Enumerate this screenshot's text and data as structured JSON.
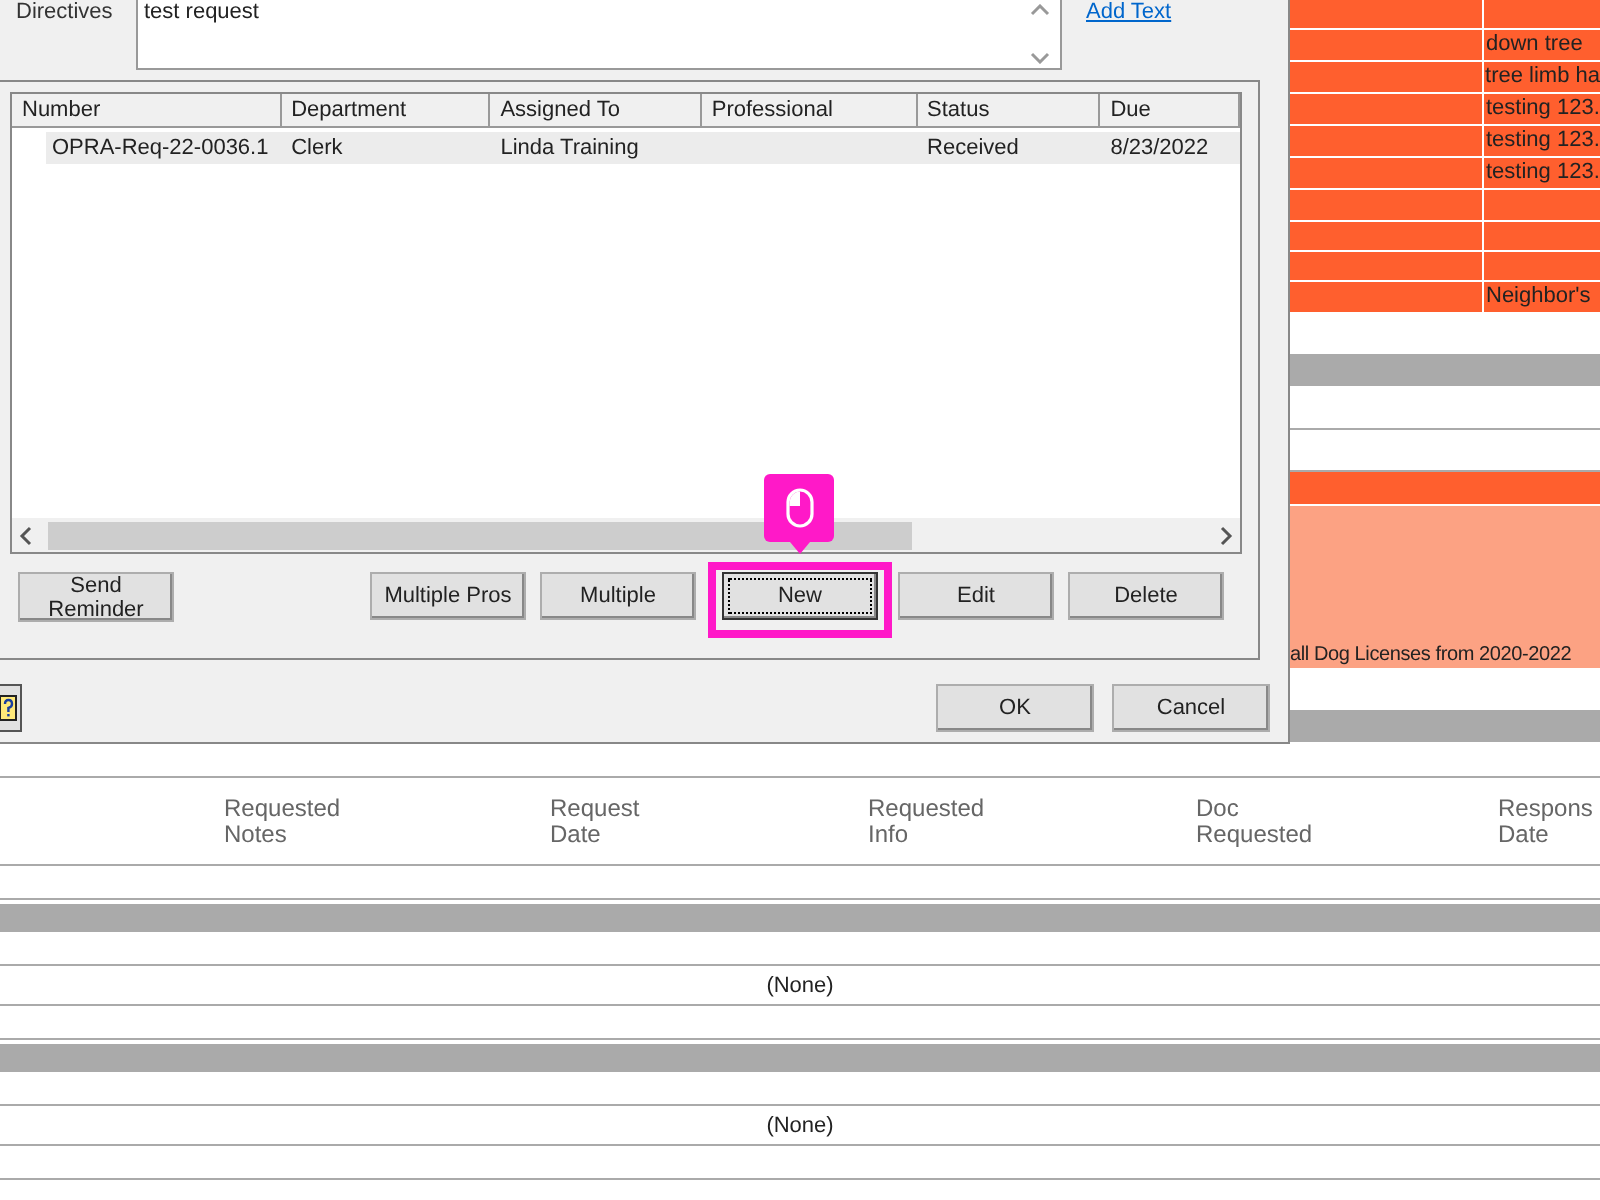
{
  "dialog": {
    "directives_label": "Directives",
    "directives": {
      "value": "test request"
    },
    "add_text_link": "Add Text",
    "list": {
      "columns": [
        "Number",
        "Department",
        "Assigned To",
        "Professional",
        "Status",
        "Due"
      ],
      "rows": [
        {
          "cells": [
            "OPRA-Req-22-0036.1",
            "Clerk",
            "Linda  Training",
            "",
            "Received",
            "8/23/2022"
          ],
          "selected": true
        }
      ]
    },
    "buttons": [
      {
        "label": "Send\nReminder",
        "focused": false,
        "highlighted": false
      },
      {
        "label": "Multiple Pros",
        "focused": false,
        "highlighted": false
      },
      {
        "label": "Multiple",
        "focused": false,
        "highlighted": false
      },
      {
        "label": "New",
        "focused": true,
        "highlighted": true
      },
      {
        "label": "Edit",
        "focused": false,
        "highlighted": false
      },
      {
        "label": "Delete",
        "focused": false,
        "highlighted": false
      }
    ],
    "footer_buttons": [
      "OK",
      "Cancel"
    ]
  },
  "right_panel": {
    "rows": [
      {
        "kind": "split",
        "color": "#ff5f2e"
      },
      {
        "kind": "split",
        "color": "#ff5f2e",
        "text": "down tree"
      },
      {
        "kind": "split",
        "color": "#ff5f2e",
        "text": "tree limb ha"
      },
      {
        "kind": "split",
        "color": "#ff5f2e",
        "text": "testing 123."
      },
      {
        "kind": "split",
        "color": "#ff5f2e",
        "text": "testing 123."
      },
      {
        "kind": "split",
        "color": "#ff5f2e",
        "text": "testing 123."
      },
      {
        "kind": "split",
        "color": "#ff5f2e"
      },
      {
        "kind": "split",
        "color": "#ff5f2e"
      },
      {
        "kind": "split",
        "color": "#ff5f2e"
      },
      {
        "kind": "split",
        "color": "#ff5f2e",
        "text": "Neighbor's"
      },
      {
        "kind": "blank",
        "color": "#ffffff"
      },
      {
        "kind": "bar",
        "color": "#aaaaaa"
      },
      {
        "kind": "blank",
        "color": "#ffffff"
      },
      {
        "kind": "blank",
        "color": "#ffffff"
      },
      {
        "kind": "bar",
        "color": "#ff5f2e"
      },
      {
        "kind": "tall",
        "color": "#fca283",
        "text": "all Dog Licenses from 2020-2022"
      },
      {
        "kind": "blank",
        "color": "#ffffff"
      },
      {
        "kind": "bar",
        "color": "#aaaaaa"
      }
    ]
  },
  "lower_table": {
    "columns": [
      "Requested\nNotes",
      "Request\nDate",
      "Requested\nInfo",
      "Doc\nRequested",
      "Respons\nDate"
    ],
    "rows": [
      {
        "kind": "blank"
      },
      {
        "kind": "header"
      },
      {
        "kind": "blank"
      },
      {
        "kind": "bar"
      },
      {
        "kind": "blank"
      },
      {
        "kind": "message",
        "text": "(None)"
      },
      {
        "kind": "blank"
      },
      {
        "kind": "bar"
      },
      {
        "kind": "blank"
      },
      {
        "kind": "message",
        "text": "(None)"
      },
      {
        "kind": "blank"
      }
    ]
  }
}
